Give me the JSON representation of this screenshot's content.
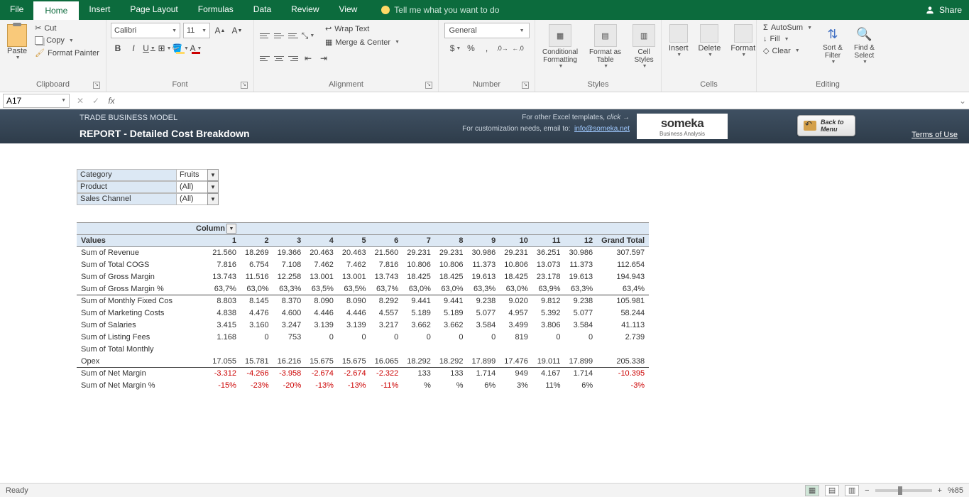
{
  "tabs": {
    "file": "File",
    "home": "Home",
    "insert": "Insert",
    "pagelayout": "Page Layout",
    "formulas": "Formulas",
    "data": "Data",
    "review": "Review",
    "view": "View",
    "tellme": "Tell me what you want to do",
    "share": "Share"
  },
  "ribbon": {
    "clipboard": {
      "label": "Clipboard",
      "paste": "Paste",
      "cut": "Cut",
      "copy": "Copy",
      "formatpainter": "Format Painter"
    },
    "font": {
      "label": "Font",
      "name": "Calibri",
      "size": "11"
    },
    "alignment": {
      "label": "Alignment",
      "wrap": "Wrap Text",
      "merge": "Merge & Center"
    },
    "number": {
      "label": "Number",
      "format": "General"
    },
    "styles": {
      "label": "Styles",
      "cond": "Conditional\nFormatting",
      "table": "Format as\nTable",
      "cell": "Cell\nStyles"
    },
    "cells": {
      "label": "Cells",
      "insert": "Insert",
      "delete": "Delete",
      "format": "Format"
    },
    "editing": {
      "label": "Editing",
      "autosum": "AutoSum",
      "fill": "Fill",
      "clear": "Clear",
      "sort": "Sort &\nFilter",
      "find": "Find &\nSelect"
    }
  },
  "namebox": "A17",
  "header": {
    "title1": "TRADE BUSINESS MODEL",
    "title2": "REPORT - Detailed Cost Breakdown",
    "other": "For other Excel templates,",
    "click": "click",
    "arrow": "→",
    "custom": "For customization needs, email to:",
    "email": "info@someka.net",
    "logo": "someka",
    "logosub": "Business Analysis",
    "back1": "Back to",
    "back2": "Menu",
    "terms": "Terms of Use"
  },
  "filters": {
    "category": {
      "label": "Category",
      "value": "Fruits"
    },
    "product": {
      "label": "Product",
      "value": "(All)"
    },
    "channel": {
      "label": "Sales Channel",
      "value": "(All)"
    }
  },
  "pivot": {
    "column_label": "Column",
    "values_label": "Values",
    "grand": "Grand Total",
    "cols": [
      "1",
      "2",
      "3",
      "4",
      "5",
      "6",
      "7",
      "8",
      "9",
      "10",
      "11",
      "12"
    ],
    "rows": [
      {
        "label": "Sum of Revenue",
        "vals": [
          "21.560",
          "18.269",
          "19.366",
          "20.463",
          "20.463",
          "21.560",
          "29.231",
          "29.231",
          "30.986",
          "29.231",
          "36.251",
          "30.986"
        ],
        "total": "307.597"
      },
      {
        "label": "Sum of Total COGS",
        "vals": [
          "7.816",
          "6.754",
          "7.108",
          "7.462",
          "7.462",
          "7.816",
          "10.806",
          "10.806",
          "11.373",
          "10.806",
          "13.073",
          "11.373"
        ],
        "total": "112.654"
      },
      {
        "label": "Sum of Gross Margin",
        "vals": [
          "13.743",
          "11.516",
          "12.258",
          "13.001",
          "13.001",
          "13.743",
          "18.425",
          "18.425",
          "19.613",
          "18.425",
          "23.178",
          "19.613"
        ],
        "total": "194.943"
      },
      {
        "label": "Sum of Gross Margin %",
        "vals": [
          "63,7%",
          "63,0%",
          "63,3%",
          "63,5%",
          "63,5%",
          "63,7%",
          "63,0%",
          "63,0%",
          "63,3%",
          "63,0%",
          "63,9%",
          "63,3%"
        ],
        "total": "63,4%",
        "border": "bottom"
      },
      {
        "label": "Sum of Monthly Fixed Cos",
        "vals": [
          "8.803",
          "8.145",
          "8.370",
          "8.090",
          "8.090",
          "8.292",
          "9.441",
          "9.441",
          "9.238",
          "9.020",
          "9.812",
          "9.238"
        ],
        "total": "105.981"
      },
      {
        "label": "Sum of Marketing Costs",
        "vals": [
          "4.838",
          "4.476",
          "4.600",
          "4.446",
          "4.446",
          "4.557",
          "5.189",
          "5.189",
          "5.077",
          "4.957",
          "5.392",
          "5.077"
        ],
        "total": "58.244"
      },
      {
        "label": "Sum of Salaries",
        "vals": [
          "3.415",
          "3.160",
          "3.247",
          "3.139",
          "3.139",
          "3.217",
          "3.662",
          "3.662",
          "3.584",
          "3.499",
          "3.806",
          "3.584"
        ],
        "total": "41.113"
      },
      {
        "label": "Sum of Listing Fees",
        "vals": [
          "1.168",
          "0",
          "753",
          "0",
          "0",
          "0",
          "0",
          "0",
          "0",
          "819",
          "0",
          "0"
        ],
        "total": "2.739"
      },
      {
        "label": "Sum of Total Monthly Opex",
        "vals": [
          "17.055",
          "15.781",
          "16.216",
          "15.675",
          "15.675",
          "16.065",
          "18.292",
          "18.292",
          "17.899",
          "17.476",
          "19.011",
          "17.899"
        ],
        "total": "205.338",
        "twoLine": true,
        "border": "bottom"
      },
      {
        "label": "Sum of Net Margin",
        "vals": [
          "-3.312",
          "-4.266",
          "-3.958",
          "-2.674",
          "-2.674",
          "-2.322",
          "133",
          "133",
          "1.714",
          "949",
          "4.167",
          "1.714"
        ],
        "total": "-10.395",
        "negs": [
          0,
          1,
          2,
          3,
          4,
          5,
          12
        ]
      },
      {
        "label": "Sum of Net Margin %",
        "vals": [
          "-15%",
          "-23%",
          "-20%",
          "-13%",
          "-13%",
          "-11%",
          "%",
          "%",
          "6%",
          "3%",
          "11%",
          "6%"
        ],
        "total": "-3%",
        "negRow": true
      }
    ]
  },
  "status": {
    "ready": "Ready",
    "zoom": "%85"
  }
}
